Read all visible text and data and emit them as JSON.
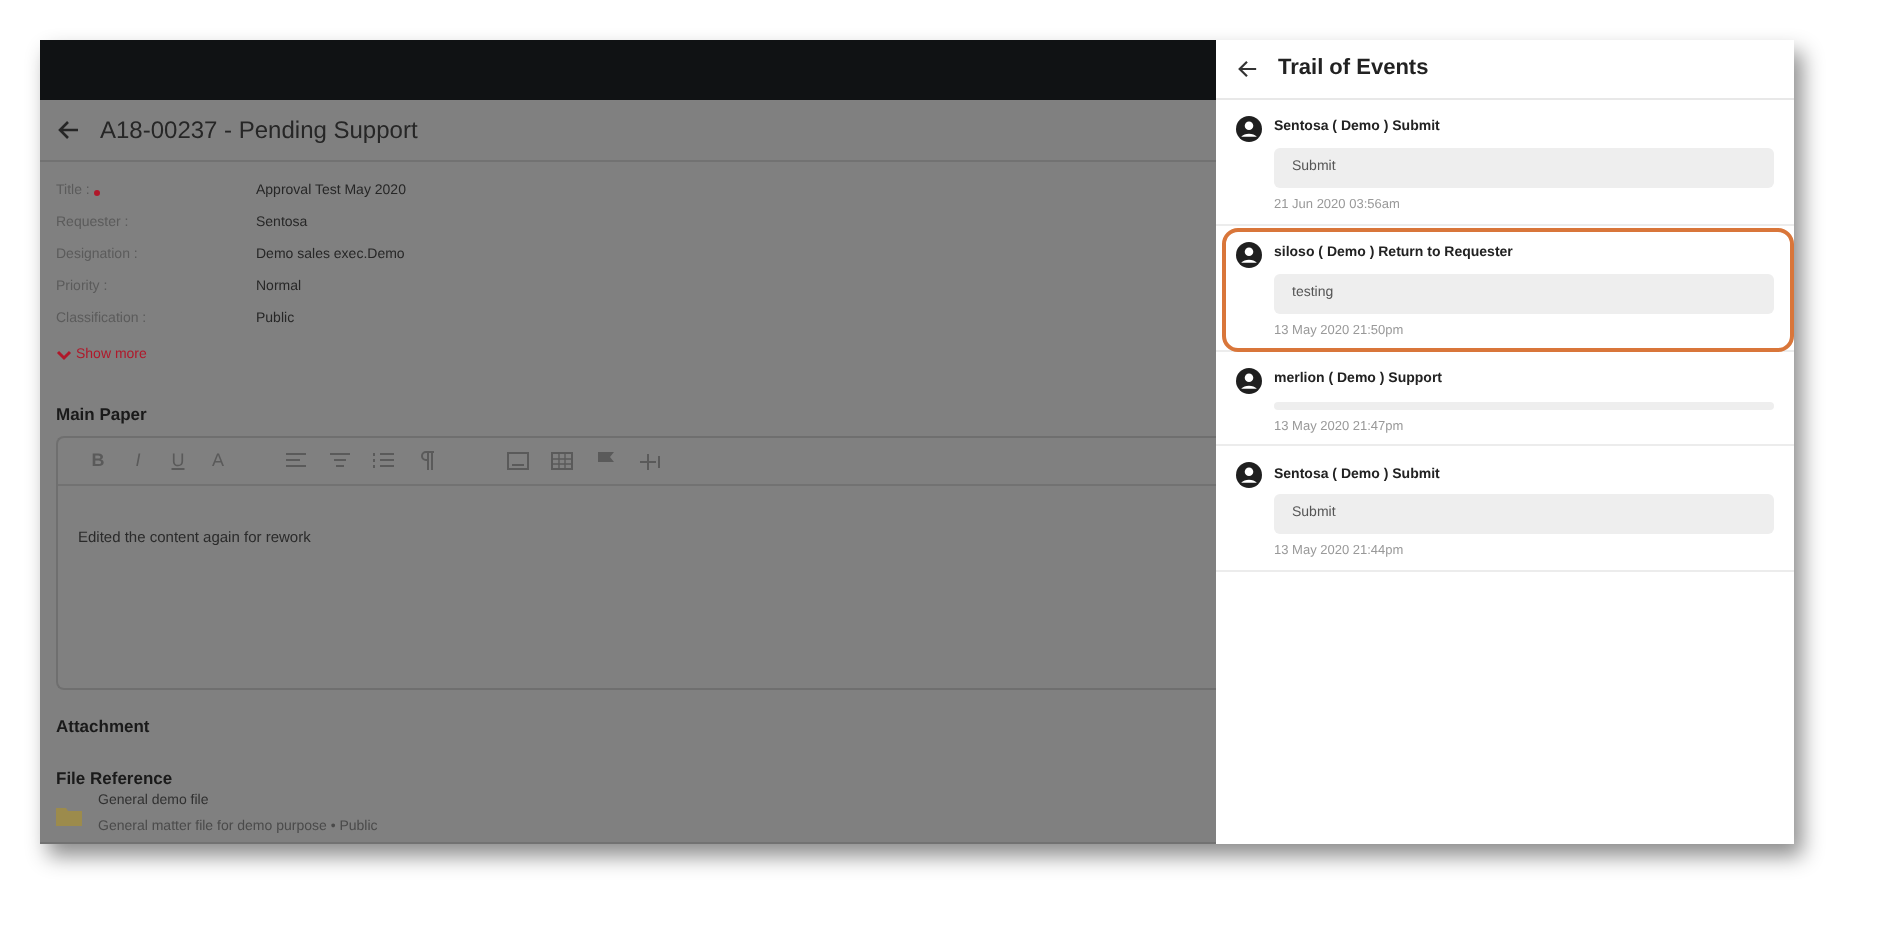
{
  "page": {
    "title": "A18-00237 - Pending Support",
    "fields": [
      {
        "label": "Title :",
        "required": true,
        "value": "Approval Test May 2020"
      },
      {
        "label": "Requester :",
        "required": false,
        "value": "Sentosa"
      },
      {
        "label": "Designation :",
        "required": false,
        "value": "Demo sales exec.Demo"
      },
      {
        "label": "Priority :",
        "required": false,
        "value": "Normal"
      },
      {
        "label": "Classification :",
        "required": false,
        "value": "Public"
      }
    ],
    "show_more": "Show more",
    "main_paper": {
      "heading": "Main Paper",
      "toolbar": [
        {
          "kind": "text",
          "label": "B"
        },
        {
          "kind": "text",
          "label": "I"
        },
        {
          "kind": "text",
          "label": "U"
        },
        {
          "kind": "text",
          "label": "A"
        },
        {
          "kind": "icon"
        },
        {
          "kind": "icon"
        },
        {
          "kind": "icon"
        },
        {
          "kind": "icon"
        },
        {
          "kind": "icon"
        },
        {
          "kind": "icon"
        },
        {
          "kind": "icon"
        },
        {
          "kind": "icon"
        }
      ],
      "content": "Edited the content again for rework"
    },
    "attachment": {
      "heading": "Attachment"
    },
    "file_reference": {
      "heading": "File Reference",
      "files": [
        {
          "name": "General demo file",
          "description": "General matter file for demo purpose • Public"
        }
      ]
    }
  },
  "drawer": {
    "title": "Trail of Events",
    "events": [
      {
        "title": "Sentosa ( Demo ) Submit",
        "comment": "Submit",
        "time": "21 Jun 2020 03:56am",
        "highlighted": false
      },
      {
        "title": "siloso ( Demo ) Return to Requester",
        "comment": "testing",
        "time": "13 May 2020 21:50pm",
        "highlighted": true
      },
      {
        "title": "merlion ( Demo ) Support",
        "time": "13 May 2020 21:47pm",
        "highlighted": false
      },
      {
        "title": "Sentosa ( Demo ) Submit",
        "comment": "Submit",
        "time": "13 May 2020 21:44pm",
        "highlighted": false
      }
    ]
  }
}
